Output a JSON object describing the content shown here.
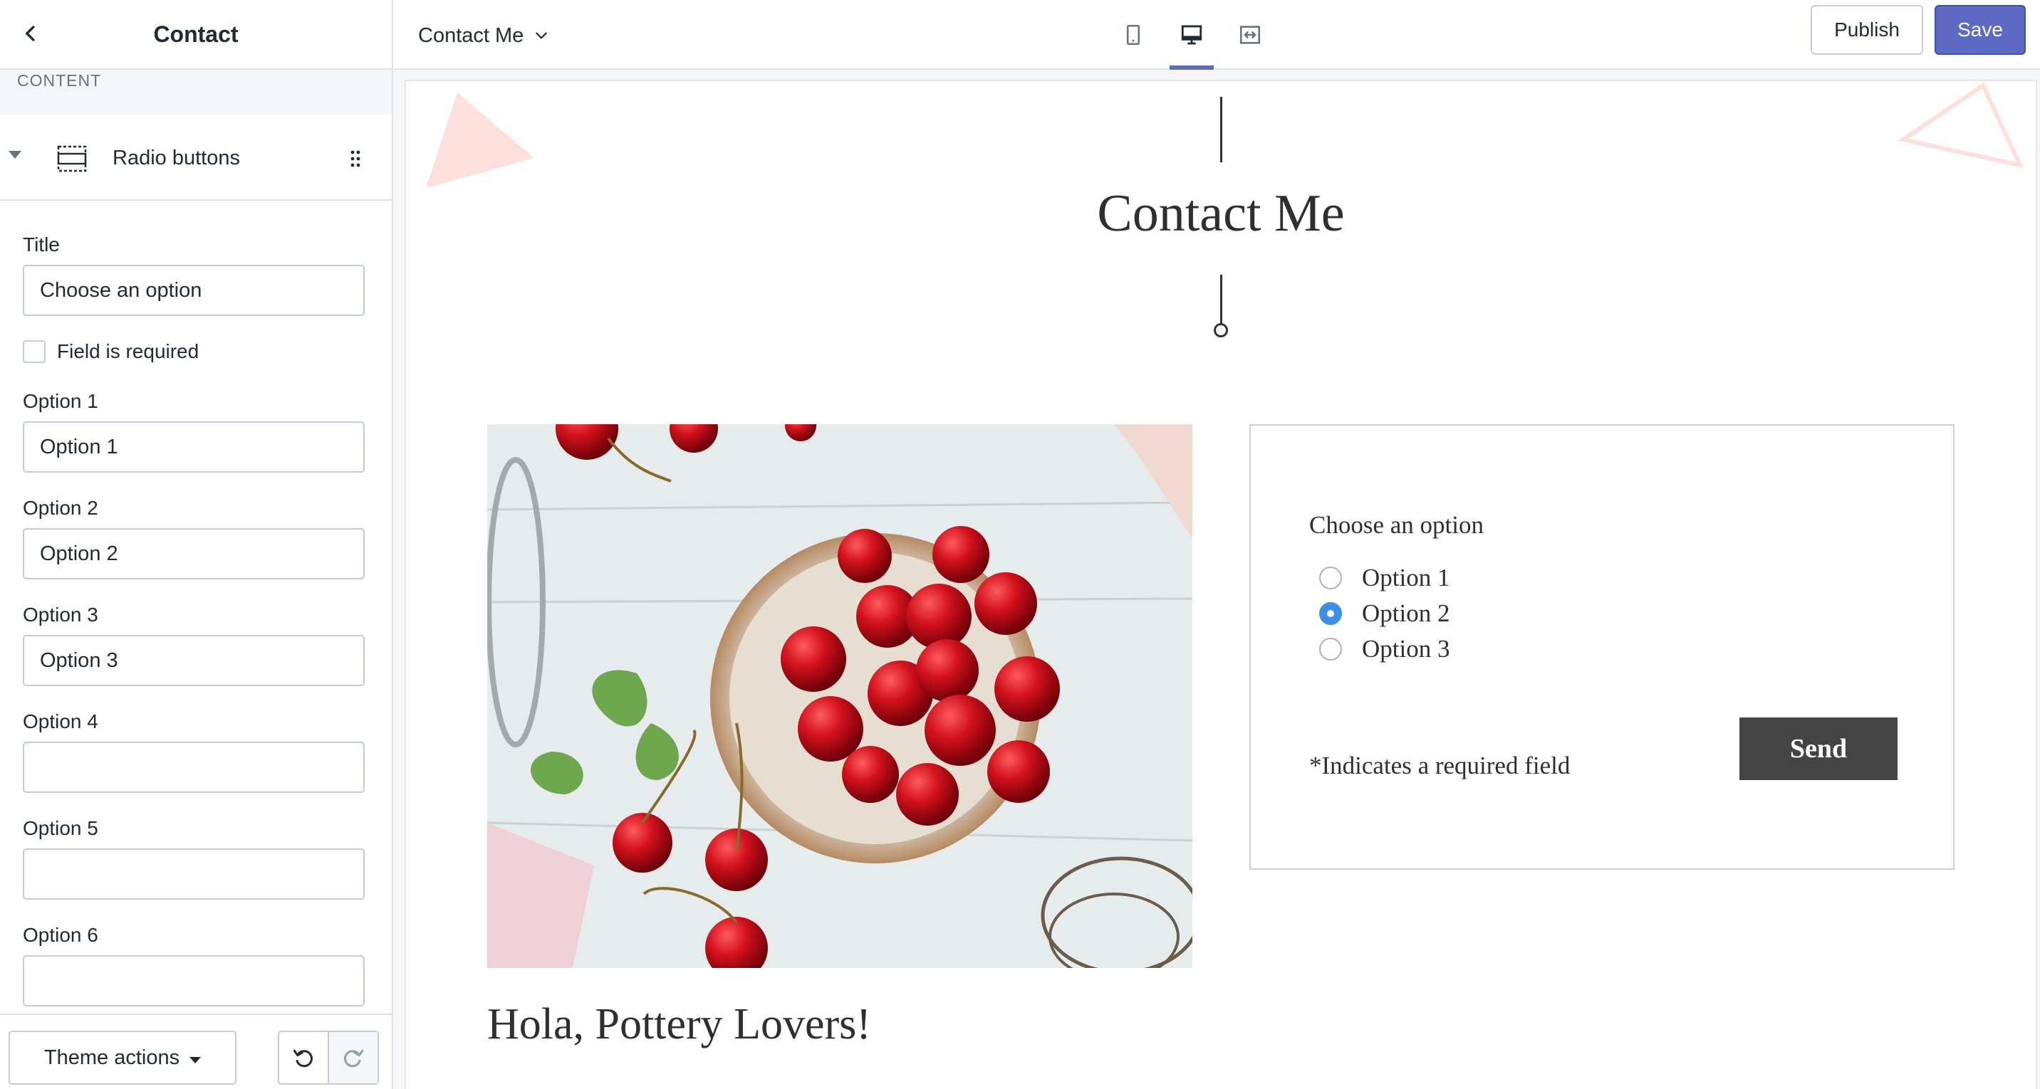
{
  "sidebar": {
    "title": "Contact",
    "section_label": "CONTENT",
    "block_label": "Radio buttons",
    "fields": {
      "title_label": "Title",
      "title_value": "Choose an option",
      "required_label": "Field is required",
      "required_checked": false,
      "option1_label": "Option 1",
      "option1_value": "Option 1",
      "option2_label": "Option 2",
      "option2_value": "Option 2",
      "option3_label": "Option 3",
      "option3_value": "Option 3",
      "option4_label": "Option 4",
      "option4_value": "",
      "option5_label": "Option 5",
      "option5_value": "",
      "option6_label": "Option 6",
      "option6_value": ""
    },
    "footer": {
      "theme_actions_label": "Theme actions"
    }
  },
  "topbar": {
    "page_name": "Contact Me",
    "devices": [
      "mobile-icon",
      "desktop-icon",
      "full-width-icon"
    ],
    "active_device": "desktop-icon",
    "publish_label": "Publish",
    "save_label": "Save",
    "accent_color": "#5c6ac4"
  },
  "preview": {
    "heading": "Contact Me",
    "form": {
      "question": "Choose an option",
      "options": [
        "Option 1",
        "Option 2",
        "Option 3"
      ],
      "selected_option": "Option 2",
      "required_note": "*Indicates a required field",
      "send_label": "Send"
    },
    "subheading": "Hola, Pottery Lovers!"
  }
}
